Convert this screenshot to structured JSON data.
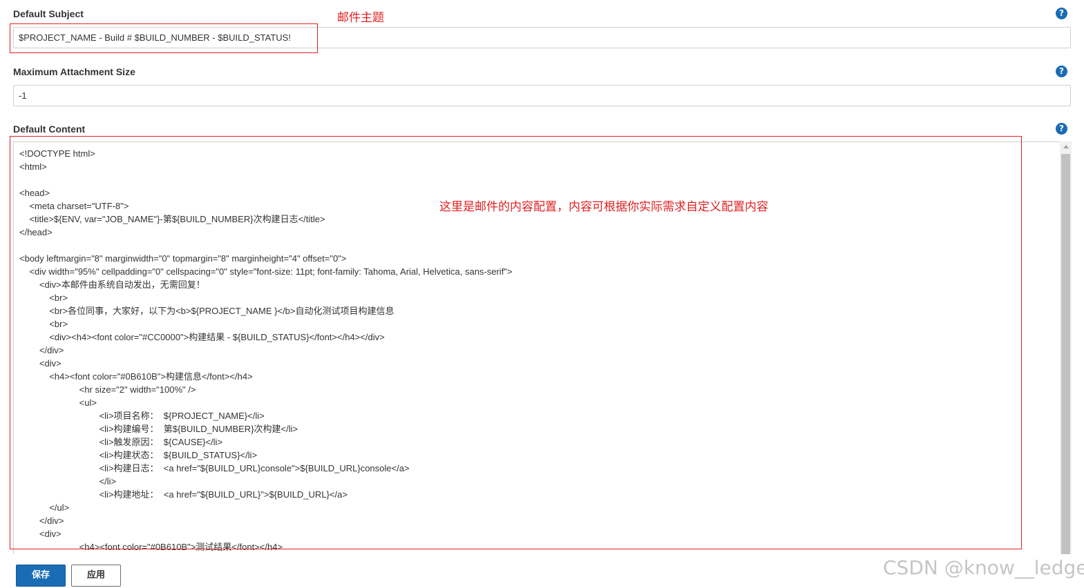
{
  "fields": {
    "subject": {
      "label": "Default Subject",
      "value": "$PROJECT_NAME - Build # $BUILD_NUMBER - $BUILD_STATUS!"
    },
    "max_attachment": {
      "label": "Maximum Attachment Size",
      "value": "-1"
    },
    "content": {
      "label": "Default Content",
      "lines": [
        "<!DOCTYPE html>",
        "<html>",
        "",
        "<head>",
        "    <meta charset=\"UTF-8\">",
        "    <title>${ENV, var=\"JOB_NAME\"}-第${BUILD_NUMBER}次构建日志</title>",
        "</head>",
        "",
        "<body leftmargin=\"8\" marginwidth=\"0\" topmargin=\"8\" marginheight=\"4\" offset=\"0\">",
        "    <div width=\"95%\" cellpadding=\"0\" cellspacing=\"0\" style=\"font-size: 11pt; font-family: Tahoma, Arial, Helvetica, sans-serif\">",
        "        <div>本邮件由系统自动发出，无需回复！",
        "            <br>",
        "            <br>各位同事，大家好，以下为<b>${PROJECT_NAME }</b>自动化测试项目构建信息",
        "            <br>",
        "            <div><h4><font color=\"#CC0000\">构建结果 - ${BUILD_STATUS}</font></h4></div>",
        "        </div>",
        "        <div>",
        "            <h4><font color=\"#0B610B\">构建信息</font></h4>",
        "                        <hr size=\"2\" width=\"100%\" />",
        "                        <ul>",
        "                                <li>项目名称：  ${PROJECT_NAME}</li>",
        "                                <li>构建编号：  第${BUILD_NUMBER}次构建</li>",
        "                                <li>触发原因：  ${CAUSE}</li>",
        "                                <li>构建状态：  ${BUILD_STATUS}</li>",
        "                                <li>构建日志：  <a href=\"${BUILD_URL}console\">${BUILD_URL}console</a>",
        "                                </li>",
        "                                <li>构建地址：  <a href=\"${BUILD_URL}\">${BUILD_URL}</a>",
        "            </ul>",
        "        </div>",
        "        <div>",
        "                        <h4><font color=\"#0B610B\">测试结果</font></h4>"
      ]
    }
  },
  "annotations": {
    "subject_note": "邮件主题",
    "content_note": "这里是邮件的内容配置，内容可根据你实际需求自定义配置内容"
  },
  "buttons": {
    "save": "保存",
    "apply": "应用"
  },
  "help_glyph": "?",
  "watermark": "CSDN @know__ledge",
  "colors": {
    "primary": "#1a6cb5",
    "annotation_red": "#e02020"
  }
}
